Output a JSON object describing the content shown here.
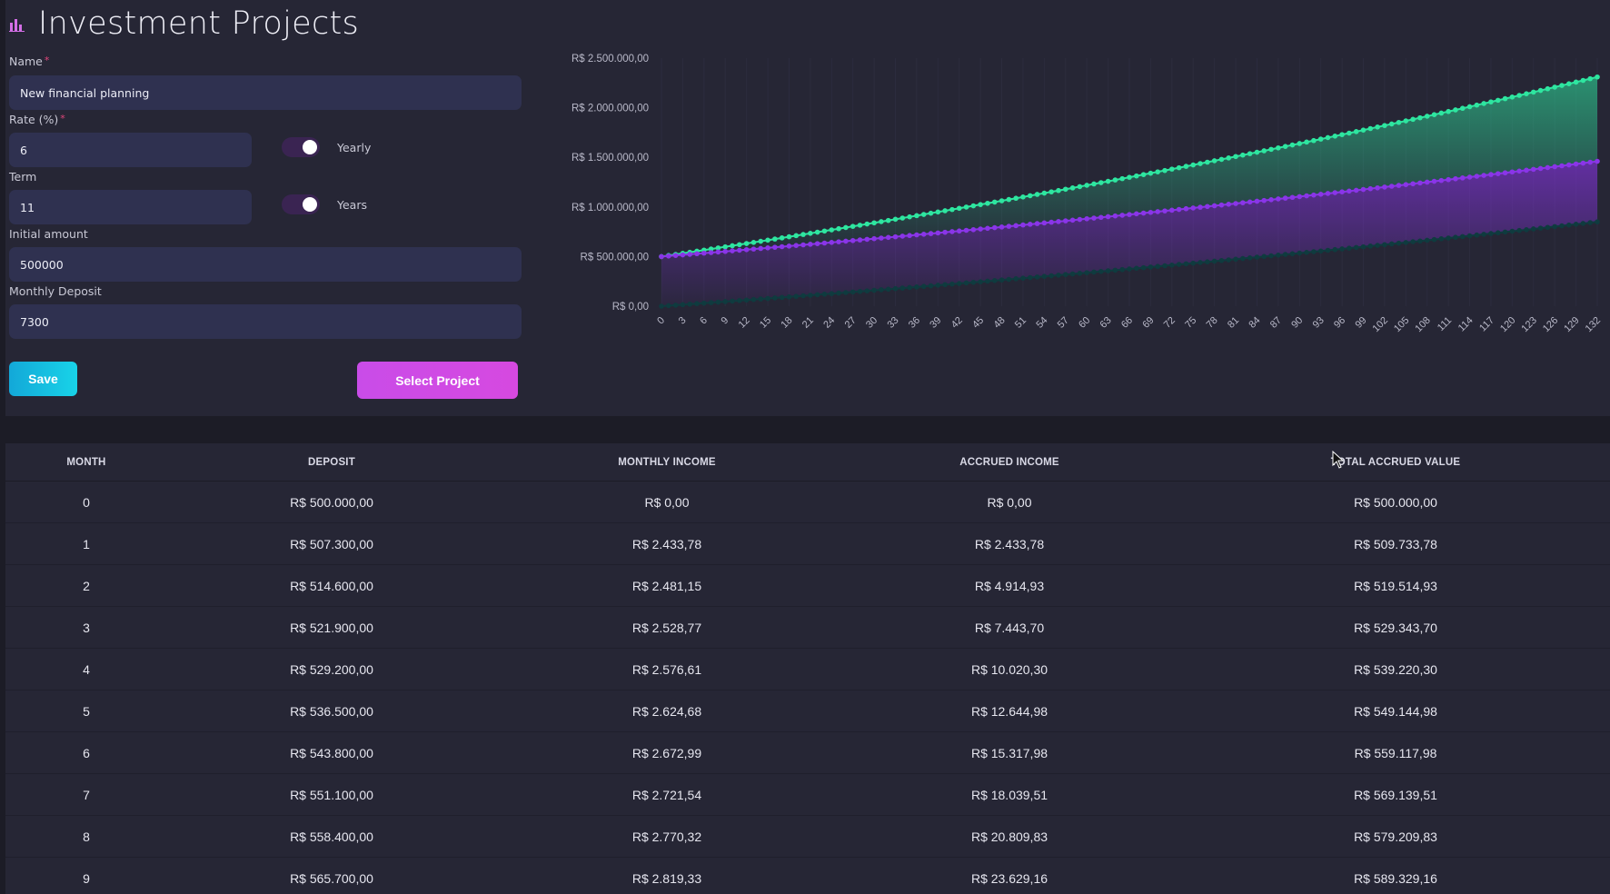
{
  "header": {
    "title": "Investment Projects",
    "icon": "bar-chart-icon"
  },
  "form": {
    "name": {
      "label": "Name",
      "required": "*",
      "value": "New financial planning"
    },
    "rate": {
      "label": "Rate (%)",
      "required": "*",
      "value": "6",
      "toggle_label": "Yearly",
      "toggle_on": true
    },
    "term": {
      "label": "Term",
      "value": "11",
      "toggle_label": "Years",
      "toggle_on": true
    },
    "initial_amount": {
      "label": "Initial amount",
      "value": "500000"
    },
    "monthly_deposit": {
      "label": "Monthly Deposit",
      "value": "7300"
    },
    "save_label": "Save",
    "select_project_label": "Select Project"
  },
  "colors": {
    "accent_green": "#2ee6a0",
    "accent_purple": "#8a35e8",
    "accent_dark": "#0f3b3f",
    "save_button": "#13a8d8",
    "select_button": "#c94ce8"
  },
  "chart_data": {
    "type": "area",
    "title": "",
    "xlabel": "",
    "ylabel": "",
    "ylim": [
      0,
      2500000
    ],
    "ytick_labels": [
      "R$ 2.500.000,00",
      "R$ 2.000.000,00",
      "R$ 1.500.000,00",
      "R$ 1.000.000,00",
      "R$ 500.000,00",
      "R$ 0,00"
    ],
    "xtick_labels": [
      "0",
      "3",
      "6",
      "9",
      "12",
      "15",
      "18",
      "21",
      "24",
      "27",
      "30",
      "33",
      "36",
      "39",
      "42",
      "45",
      "48",
      "51",
      "54",
      "57",
      "60",
      "63",
      "66",
      "69",
      "72",
      "75",
      "78",
      "81",
      "84",
      "87",
      "90",
      "93",
      "96",
      "99",
      "102",
      "105",
      "108",
      "111",
      "114",
      "117",
      "120",
      "123",
      "126",
      "129",
      "132"
    ],
    "x_range": [
      0,
      132
    ],
    "grid": true,
    "series": [
      {
        "color": "#2ee6a0",
        "start": 500000,
        "end": 2310000
      },
      {
        "color": "#8a35e8",
        "start": 500000,
        "end": 1460000
      },
      {
        "color": "#0f3b3f",
        "start": 0,
        "end": 850000
      }
    ]
  },
  "table": {
    "headers": [
      "MONTH",
      "DEPOSIT",
      "MONTHLY INCOME",
      "ACCRUED INCOME",
      "TOTAL ACCRUED VALUE"
    ],
    "rows": [
      [
        "0",
        "R$ 500.000,00",
        "R$ 0,00",
        "R$ 0,00",
        "R$ 500.000,00"
      ],
      [
        "1",
        "R$ 507.300,00",
        "R$ 2.433,78",
        "R$ 2.433,78",
        "R$ 509.733,78"
      ],
      [
        "2",
        "R$ 514.600,00",
        "R$ 2.481,15",
        "R$ 4.914,93",
        "R$ 519.514,93"
      ],
      [
        "3",
        "R$ 521.900,00",
        "R$ 2.528,77",
        "R$ 7.443,70",
        "R$ 529.343,70"
      ],
      [
        "4",
        "R$ 529.200,00",
        "R$ 2.576,61",
        "R$ 10.020,30",
        "R$ 539.220,30"
      ],
      [
        "5",
        "R$ 536.500,00",
        "R$ 2.624,68",
        "R$ 12.644,98",
        "R$ 549.144,98"
      ],
      [
        "6",
        "R$ 543.800,00",
        "R$ 2.672,99",
        "R$ 15.317,98",
        "R$ 559.117,98"
      ],
      [
        "7",
        "R$ 551.100,00",
        "R$ 2.721,54",
        "R$ 18.039,51",
        "R$ 569.139,51"
      ],
      [
        "8",
        "R$ 558.400,00",
        "R$ 2.770,32",
        "R$ 20.809,83",
        "R$ 579.209,83"
      ],
      [
        "9",
        "R$ 565.700,00",
        "R$ 2.819,33",
        "R$ 23.629,16",
        "R$ 589.329,16"
      ]
    ]
  }
}
